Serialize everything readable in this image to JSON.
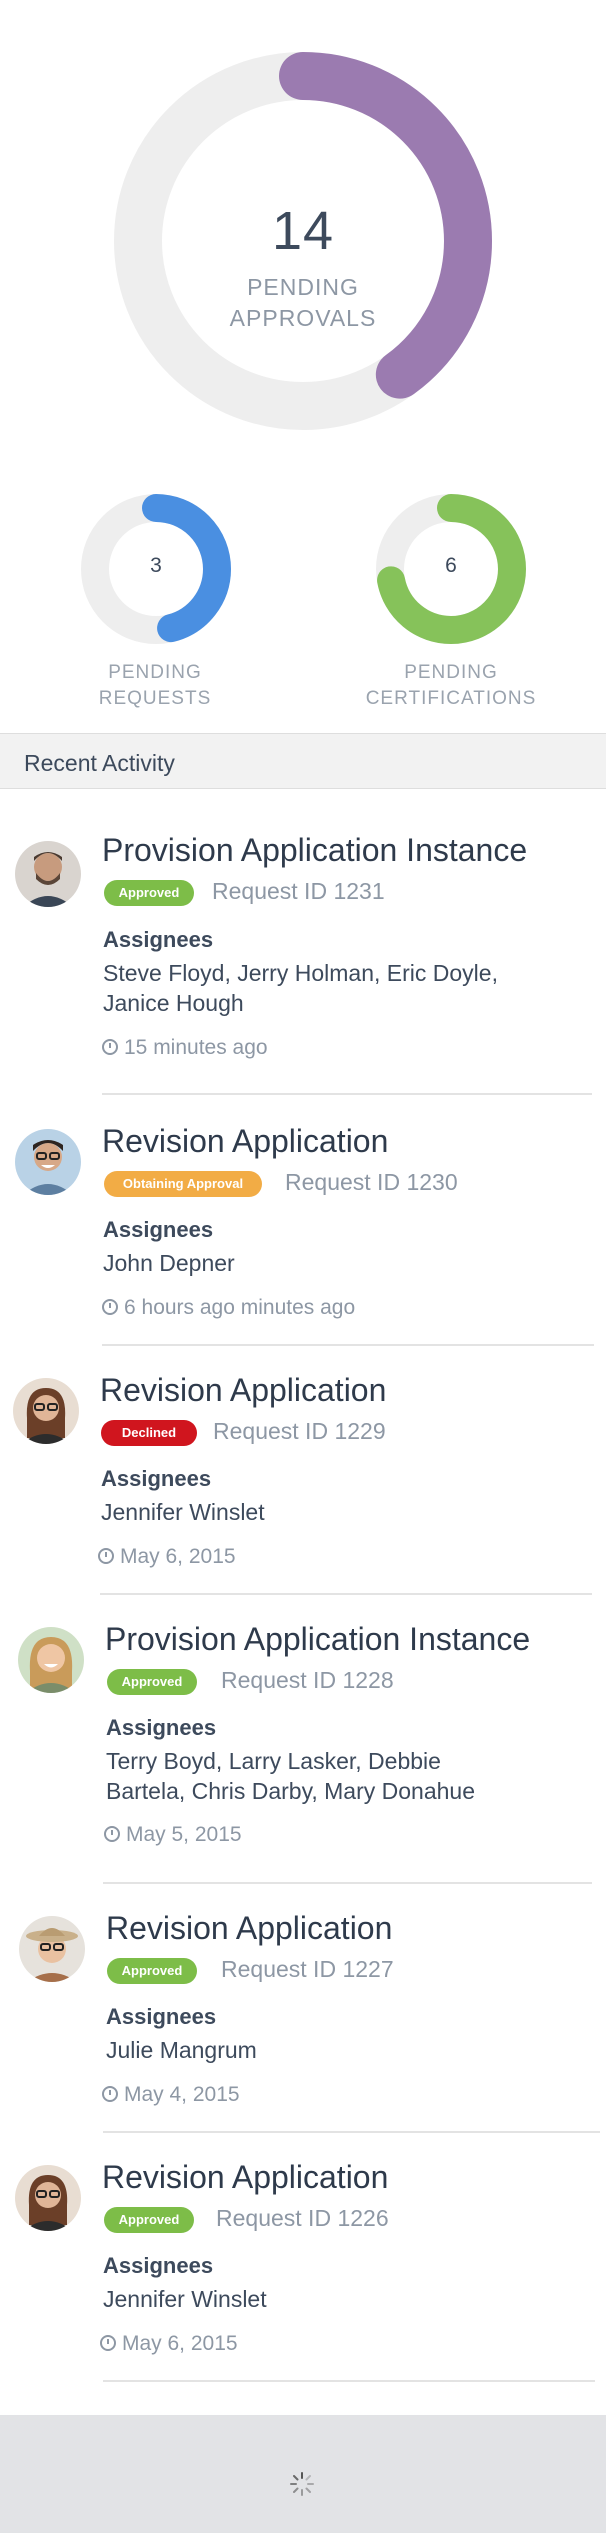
{
  "summary": {
    "main": {
      "count": "14",
      "label_line1": "PENDING",
      "label_line2": "APPROVALS",
      "color": "#9b7bb0",
      "fraction": 0.4
    },
    "requests": {
      "count": "3",
      "label_line1": "PENDING",
      "label_line2": "REQUESTS",
      "color": "#4a8fe1",
      "fraction": 0.46
    },
    "certifications": {
      "count": "6",
      "label_line1": "PENDING",
      "label_line2": "CERTIFICATIONS",
      "color": "#86c25a",
      "fraction": 0.72
    }
  },
  "section_title": "Recent Activity",
  "activities": [
    {
      "title": "Provision Application Instance",
      "status": "Approved",
      "status_type": "approved",
      "request_id": "Request ID 1231",
      "assignees_label": "Assignees",
      "assignees": "Steve Floyd, Jerry Holman, Eric Doyle, Janice Hough",
      "time": "15 minutes ago",
      "avatar": "man-beard-avatar"
    },
    {
      "title": "Revision Application",
      "status": "Obtaining Approval",
      "status_type": "obtaining",
      "request_id": "Request ID 1230",
      "assignees_label": "Assignees",
      "assignees": "John Depner",
      "time": "6 hours ago minutes ago",
      "avatar": "man-glasses-avatar"
    },
    {
      "title": "Revision Application",
      "status": "Declined",
      "status_type": "declined",
      "request_id": "Request ID 1229",
      "assignees_label": "Assignees",
      "assignees": "Jennifer Winslet",
      "time": "May 6, 2015",
      "avatar": "woman-glasses-avatar"
    },
    {
      "title": "Provision Application Instance",
      "status": "Approved",
      "status_type": "approved",
      "request_id": "Request ID 1228",
      "assignees_label": "Assignees",
      "assignees": "Terry Boyd, Larry Lasker, Debbie Bartela, Chris Darby, Mary Donahue",
      "time": "May 5, 2015",
      "avatar": "woman-smiling-avatar"
    },
    {
      "title": "Revision Application",
      "status": "Approved",
      "status_type": "approved",
      "request_id": "Request ID 1227",
      "assignees_label": "Assignees",
      "assignees": "Julie Mangrum",
      "time": "May 4, 2015",
      "avatar": "woman-hat-avatar"
    },
    {
      "title": "Revision Application",
      "status": "Approved",
      "status_type": "approved",
      "request_id": "Request ID 1226",
      "assignees_label": "Assignees",
      "assignees": "Jennifer Winslet",
      "time": "May 6, 2015",
      "avatar": "woman-glasses-avatar"
    }
  ],
  "footer": {
    "icon": "loading-spinner-icon"
  }
}
